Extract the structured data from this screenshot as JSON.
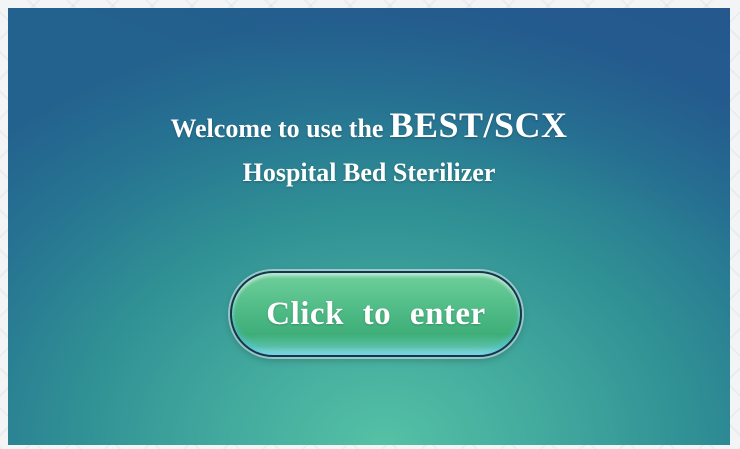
{
  "welcome": {
    "prefix": "Welcome to use the",
    "brand": "BEST/SCX",
    "product": "Hospital Bed Sterilizer"
  },
  "enter_button": {
    "label": "Click to enter"
  },
  "colors": {
    "screen_bottom": "#55c1a5",
    "screen_top": "#23618e",
    "button_green": "#4fbb86",
    "button_border": "#17354f",
    "text": "#ffffff"
  }
}
